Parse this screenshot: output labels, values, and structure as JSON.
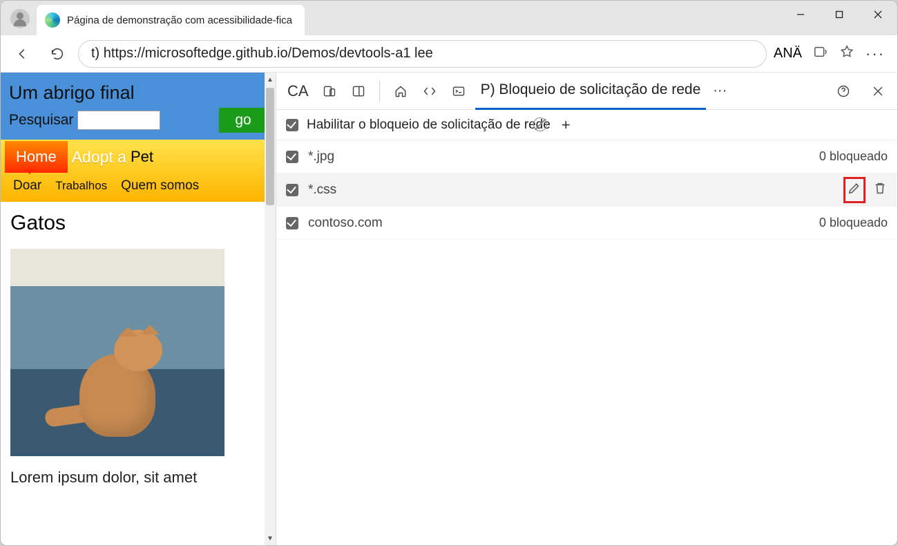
{
  "browser": {
    "tab_title": "Página de demonstração com acessibilidade-fica",
    "url_display": "t) https://microsoftedge.github.io/Demos/devtools-a1 lee",
    "reader_label": "ANÄ"
  },
  "page": {
    "title": "Um abrigo final",
    "search_label": "Pesquisar",
    "go_label": "go",
    "nav": {
      "home": "Home",
      "adopt": "Adopt a",
      "pet": "Pet",
      "donate": "Doar",
      "jobs": "Trabalhos",
      "about": "Quem somos"
    },
    "heading": "Gatos",
    "lorem": "Lorem ipsum dolor, sit amet"
  },
  "devtools": {
    "ca_label": "CA",
    "active_tab": "P) Bloqueio de solicitação de rede",
    "enable_label": "Habilitar o bloqueio de solicitação de rede",
    "add_symbol": "+",
    "patterns": [
      {
        "name": "*.jpg",
        "blocked": "0 bloqueado",
        "hover": false
      },
      {
        "name": "*.css",
        "blocked": "",
        "hover": true
      },
      {
        "name": "contoso.com",
        "blocked": "0 bloqueado",
        "hover": false
      }
    ]
  }
}
